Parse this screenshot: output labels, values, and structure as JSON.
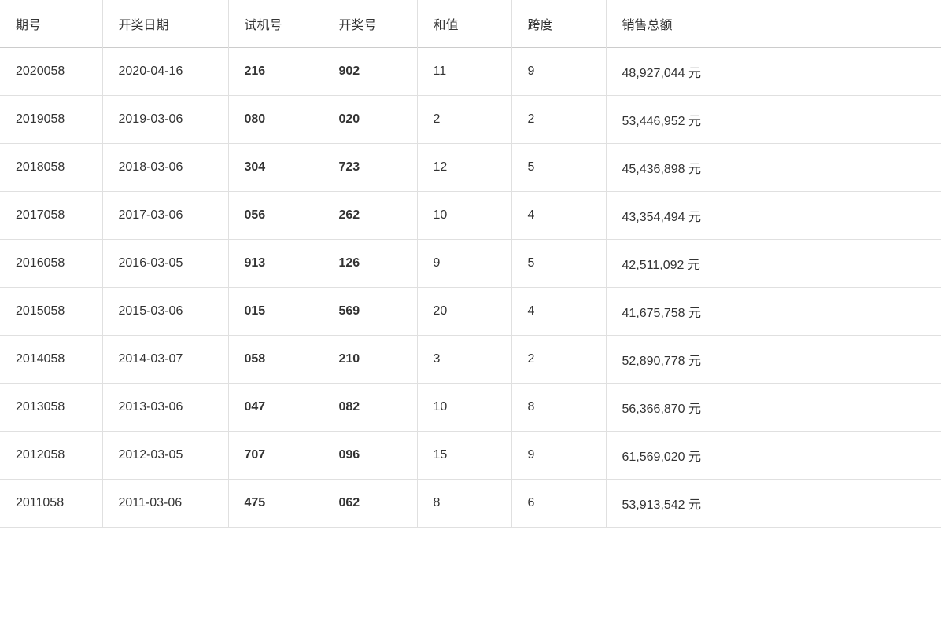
{
  "table": {
    "columns": [
      {
        "key": "period",
        "label": "期号"
      },
      {
        "key": "date",
        "label": "开奖日期"
      },
      {
        "key": "trial",
        "label": "试机号"
      },
      {
        "key": "winning",
        "label": "开奖号"
      },
      {
        "key": "sum",
        "label": "和值"
      },
      {
        "key": "span",
        "label": "跨度"
      },
      {
        "key": "sales",
        "label": "销售总额"
      }
    ],
    "rows": [
      {
        "period": "2020058",
        "date": "2020-04-16",
        "trial": "216",
        "winning": "902",
        "sum": "11",
        "span": "9",
        "sales": "48,927,044 元"
      },
      {
        "period": "2019058",
        "date": "2019-03-06",
        "trial": "080",
        "winning": "020",
        "sum": "2",
        "span": "2",
        "sales": "53,446,952 元"
      },
      {
        "period": "2018058",
        "date": "2018-03-06",
        "trial": "304",
        "winning": "723",
        "sum": "12",
        "span": "5",
        "sales": "45,436,898 元"
      },
      {
        "period": "2017058",
        "date": "2017-03-06",
        "trial": "056",
        "winning": "262",
        "sum": "10",
        "span": "4",
        "sales": "43,354,494 元"
      },
      {
        "period": "2016058",
        "date": "2016-03-05",
        "trial": "913",
        "winning": "126",
        "sum": "9",
        "span": "5",
        "sales": "42,511,092 元"
      },
      {
        "period": "2015058",
        "date": "2015-03-06",
        "trial": "015",
        "winning": "569",
        "sum": "20",
        "span": "4",
        "sales": "41,675,758 元"
      },
      {
        "period": "2014058",
        "date": "2014-03-07",
        "trial": "058",
        "winning": "210",
        "sum": "3",
        "span": "2",
        "sales": "52,890,778 元"
      },
      {
        "period": "2013058",
        "date": "2013-03-06",
        "trial": "047",
        "winning": "082",
        "sum": "10",
        "span": "8",
        "sales": "56,366,870 元"
      },
      {
        "period": "2012058",
        "date": "2012-03-05",
        "trial": "707",
        "winning": "096",
        "sum": "15",
        "span": "9",
        "sales": "61,569,020 元"
      },
      {
        "period": "2011058",
        "date": "2011-03-06",
        "trial": "475",
        "winning": "062",
        "sum": "8",
        "span": "6",
        "sales": "53,913,542 元"
      }
    ]
  }
}
